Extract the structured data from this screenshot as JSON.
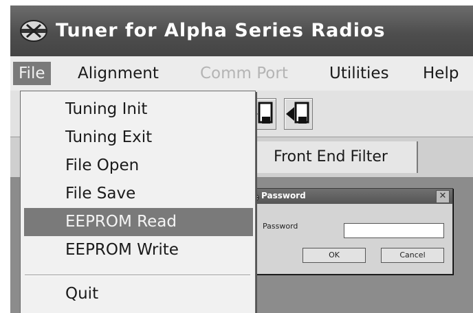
{
  "window": {
    "title": "Tuner for Alpha Series Radios",
    "app_icon": "radio-tuner-icon"
  },
  "menubar": {
    "items": [
      {
        "label": "File",
        "state": "open"
      },
      {
        "label": "Alignment",
        "state": "normal"
      },
      {
        "label": "Comm Port",
        "state": "disabled"
      },
      {
        "label": "Utilities",
        "state": "normal"
      },
      {
        "label": "Help",
        "state": "normal"
      }
    ]
  },
  "file_menu": {
    "items": [
      "Tuning Init",
      "Tuning Exit",
      "File Open",
      "File Save",
      "EEPROM Read",
      "EEPROM Write"
    ],
    "highlighted": "EEPROM Read",
    "after_separator": "Quit"
  },
  "toolbar": {
    "buttons": [
      "arrow-right-into-device-icon",
      "arrow-left-from-device-icon"
    ]
  },
  "tabs": {
    "front_end_filter": "Front End Filter"
  },
  "password_dialog": {
    "title": "Password",
    "field_label": "Password",
    "field_value": "",
    "ok_label": "OK",
    "cancel_label": "Cancel",
    "close_glyph": "✕"
  },
  "colors": {
    "titlebar": "#555555",
    "menu_highlight": "#7a7a7a",
    "disabled_text": "#b4b4b4"
  }
}
